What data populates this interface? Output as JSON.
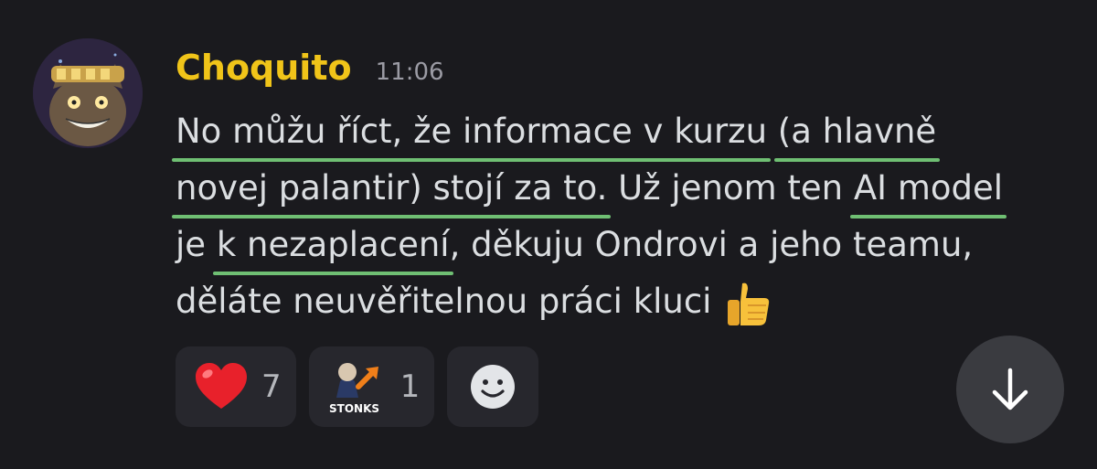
{
  "message": {
    "author": "Choquito",
    "time": "11:06",
    "lines": [
      [
        {
          "text": "No můžu říct, že informace v kurzu",
          "underline": true
        },
        {
          "text": " ",
          "underline": false
        },
        {
          "text": "(a hlavně",
          "underline": true
        }
      ],
      [
        {
          "text": "novej palantir) stojí za to.",
          "underline": true
        },
        {
          "text": " Už jenom ten ",
          "underline": false
        },
        {
          "text": "AI model",
          "underline": true
        }
      ],
      [
        {
          "text": "je ",
          "underline": false
        },
        {
          "text": "k nezaplacení",
          "underline": true
        },
        {
          "text": ", děkuju Ondrovi a jeho teamu,",
          "underline": false
        }
      ],
      [
        {
          "text": "děláte neuvěřitelnou práci kluci",
          "underline": false
        }
      ]
    ],
    "trailing_emoji": "thumbs-up"
  },
  "reactions": [
    {
      "emoji": "heart",
      "count": "7"
    },
    {
      "emoji": "stonks",
      "label": "STONKS",
      "count": "1"
    }
  ],
  "colors": {
    "background": "#1a1a1e",
    "username": "#f0c419",
    "underline": "#6fbf73",
    "text": "#dbdee1"
  }
}
